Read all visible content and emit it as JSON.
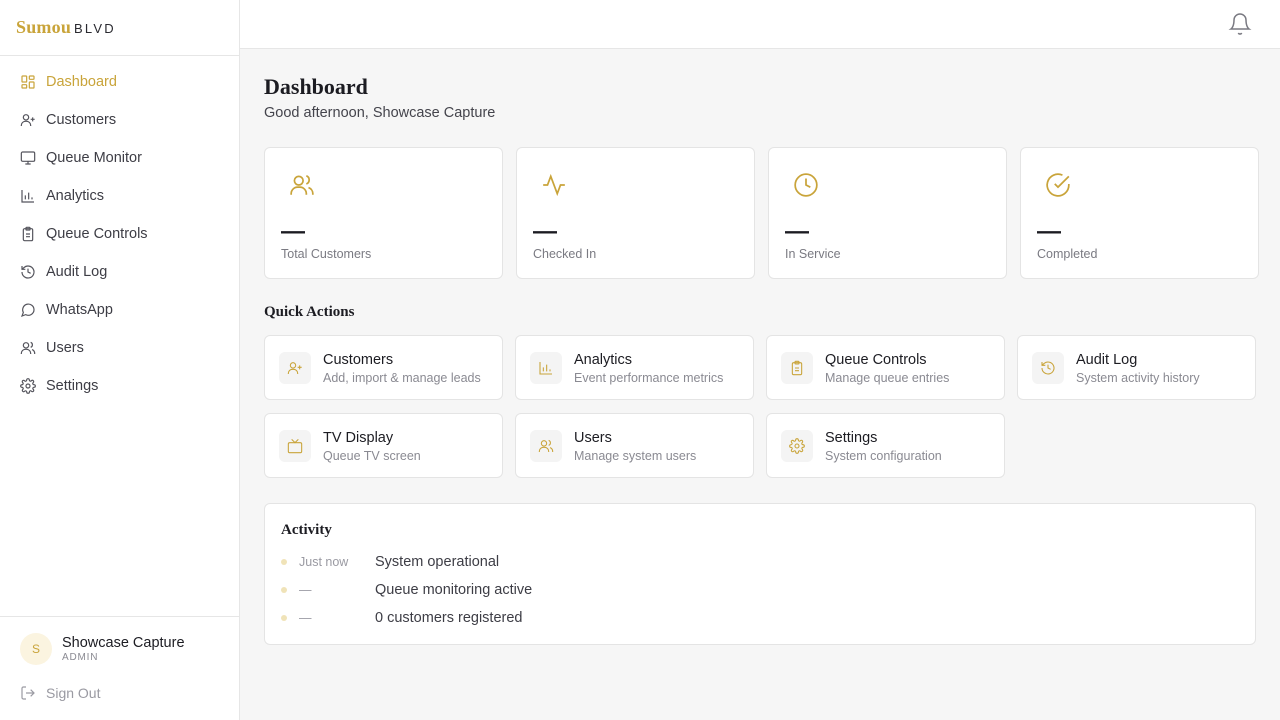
{
  "brand": {
    "name_main": "Sumou",
    "name_suffix": "BLVD"
  },
  "colors": {
    "accent": "#c9a43a",
    "text": "#1c1c22",
    "muted": "#7a7a82"
  },
  "sidebar": {
    "items": [
      {
        "label": "Dashboard",
        "icon": "grid-icon",
        "active": true
      },
      {
        "label": "Customers",
        "icon": "user-plus-icon"
      },
      {
        "label": "Queue Monitor",
        "icon": "monitor-icon"
      },
      {
        "label": "Analytics",
        "icon": "bar-chart-icon"
      },
      {
        "label": "Queue Controls",
        "icon": "clipboard-icon"
      },
      {
        "label": "Audit Log",
        "icon": "history-icon"
      },
      {
        "label": "WhatsApp",
        "icon": "message-circle-icon"
      },
      {
        "label": "Users",
        "icon": "users-icon"
      },
      {
        "label": "Settings",
        "icon": "gear-icon"
      }
    ],
    "user": {
      "initial": "S",
      "name": "Showcase Capture",
      "role": "ADMIN"
    },
    "sign_out": "Sign Out"
  },
  "header": {
    "notifications_icon": "bell-icon"
  },
  "main": {
    "title": "Dashboard",
    "greeting": "Good afternoon, Showcase Capture",
    "stats": [
      {
        "icon": "users-icon",
        "value": "—",
        "label": "Total Customers"
      },
      {
        "icon": "activity-icon",
        "value": "—",
        "label": "Checked In"
      },
      {
        "icon": "clock-icon",
        "value": "—",
        "label": "In Service"
      },
      {
        "icon": "check-circle-icon",
        "value": "—",
        "label": "Completed"
      }
    ],
    "quick_actions_title": "Quick Actions",
    "quick_actions": [
      {
        "name": "Customers",
        "desc": "Add, import & manage leads",
        "icon": "user-plus-icon"
      },
      {
        "name": "Analytics",
        "desc": "Event performance metrics",
        "icon": "bar-chart-icon"
      },
      {
        "name": "Queue Controls",
        "desc": "Manage queue entries",
        "icon": "clipboard-icon"
      },
      {
        "name": "Audit Log",
        "desc": "System activity history",
        "icon": "history-icon"
      },
      {
        "name": "TV Display",
        "desc": "Queue TV screen",
        "icon": "tv-icon"
      },
      {
        "name": "Users",
        "desc": "Manage system users",
        "icon": "users-icon"
      },
      {
        "name": "Settings",
        "desc": "System configuration",
        "icon": "gear-icon"
      }
    ],
    "activity_title": "Activity",
    "activity": [
      {
        "time": "Just now",
        "text": "System operational"
      },
      {
        "time": "—",
        "text": "Queue monitoring active"
      },
      {
        "time": "—",
        "text": "0 customers registered"
      }
    ]
  }
}
